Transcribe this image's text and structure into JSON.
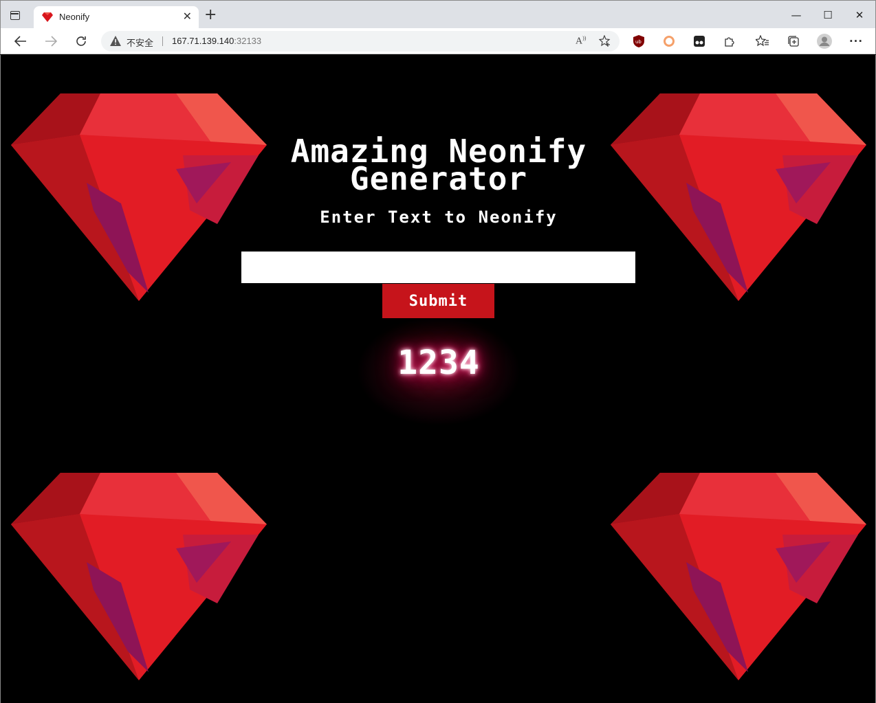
{
  "browser": {
    "tab_title": "Neonify",
    "tab_close": "✕",
    "new_tab": "+",
    "address": {
      "security_label": "不安全",
      "host": "167.71.139.140",
      "port": ":32133"
    },
    "window_controls": [
      "—",
      "☐",
      "✕"
    ]
  },
  "page": {
    "title_line1": "Amazing Neonify",
    "title_line2": "Generator",
    "subtitle": "Enter Text to Neonify",
    "input": {
      "value": "",
      "placeholder": ""
    },
    "submit_label": "Submit",
    "neon_output": "1234"
  },
  "colors": {
    "background": "#000000",
    "button": "#c6141b",
    "glow": "#e0115f",
    "gem_red": "#e21c25",
    "gem_dark": "#a8121a",
    "gem_light": "#f0564c",
    "gem_purple": "#8e1456"
  }
}
